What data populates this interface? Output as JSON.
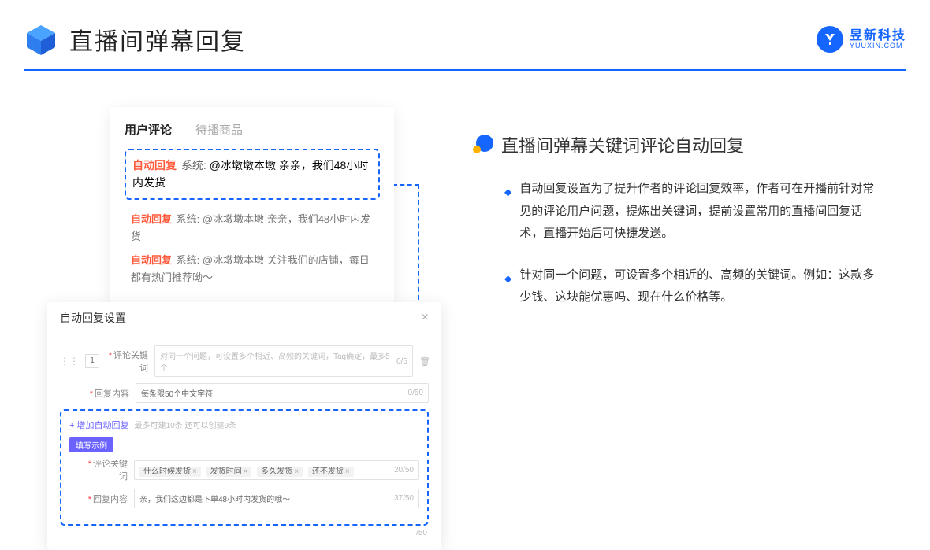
{
  "header": {
    "title": "直播间弹幕回复"
  },
  "logo": {
    "cn": "昱新科技",
    "en": "YUUXIN.COM"
  },
  "tabs": {
    "active": "用户评论",
    "inactive": "待播商品"
  },
  "comments": {
    "highlighted": {
      "tag": "自动回复",
      "sys": "系统:",
      "body": "@冰墩墩本墩 亲亲，我们48小时内发货"
    },
    "line2": {
      "tag": "自动回复",
      "sys": "系统:",
      "body": "@冰墩墩本墩 亲亲，我们48小时内发货"
    },
    "line3": {
      "tag": "自动回复",
      "sys": "系统:",
      "body": "@冰墩墩本墩 关注我们的店铺，每日都有热门推荐呦～"
    }
  },
  "settings": {
    "title": "自动回复设置",
    "rank": "1",
    "kwLabel": "评论关键词",
    "kwPlaceholder": "对同一个问题，可设置多个相近、高频的关键词，Tag确定，最多5个",
    "kwCount": "0/5",
    "contentLabel": "回复内容",
    "contentPlaceholder": "每条限50个中文字符",
    "contentCount": "0/50",
    "addLink": "+ 增加自动回复",
    "addHelp": "最多可建10条 还可以创建9条",
    "exBadge": "填写示例",
    "exKwLabel": "评论关键词",
    "exTags": [
      "什么时候发货",
      "发货时间",
      "多久发货",
      "还不发货"
    ],
    "exKwCount": "20/50",
    "exContentLabel": "回复内容",
    "exContentText": "亲，我们这边都是下单48小时内发货的哦～",
    "exContentCount": "37/50",
    "tailCount": "/50"
  },
  "right": {
    "sectionTitle": "直播间弹幕关键词评论自动回复",
    "b1": "自动回复设置为了提升作者的评论回复效率，作者可在开播前针对常见的评论用户问题，提炼出关键词，提前设置常用的直播间回复话术，直播开始后可快捷发送。",
    "b2": "针对同一个问题，可设置多个相近的、高频的关键词。例如：这款多少钱、这块能优惠吗、现在什么价格等。"
  }
}
